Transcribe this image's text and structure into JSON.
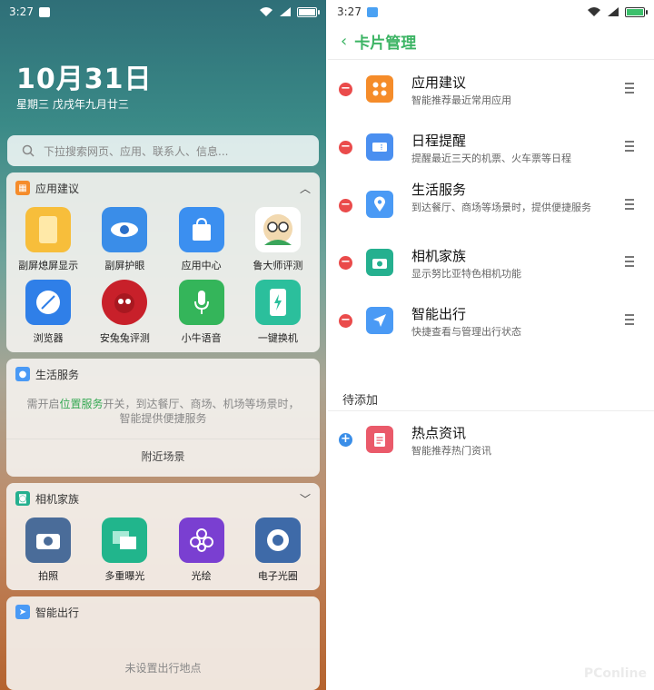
{
  "left": {
    "status": {
      "time": "3:27"
    },
    "date": "10月31日",
    "date_sub": "星期三 戊戌年九月廿三",
    "search_placeholder": "下拉搜索网页、应用、联系人、信息...",
    "app_suggest": {
      "title": "应用建议",
      "apps": [
        {
          "label": "副屏熄屏显示",
          "icon": "phone-screen-icon",
          "color": "#f5b42a"
        },
        {
          "label": "副屏护眼",
          "icon": "eye-icon",
          "color": "#3a8de8"
        },
        {
          "label": "应用中心",
          "icon": "shopping-bag-icon",
          "color": "#3b8ff0"
        },
        {
          "label": "鲁大师评测",
          "icon": "ludashi-avatar-icon",
          "color": "#ffffff"
        },
        {
          "label": "浏览器",
          "icon": "browser-icon",
          "color": "#2f7fe8"
        },
        {
          "label": "安兔兔评测",
          "icon": "antutu-icon",
          "color": "#c8202a"
        },
        {
          "label": "小牛语音",
          "icon": "microphone-icon",
          "color": "#34b55a"
        },
        {
          "label": "一键换机",
          "icon": "phone-transfer-icon",
          "color": "#2bbf9c"
        }
      ]
    },
    "life": {
      "title": "生活服务",
      "text_pre": "需开启",
      "text_link": "位置服务",
      "text_post": "开关，到达餐厅、商场、机场等场景时，智能提供便捷服务",
      "button": "附近场景"
    },
    "camera": {
      "title": "相机家族",
      "apps": [
        {
          "label": "拍照",
          "icon": "camera-icon",
          "color": "#4a6c99"
        },
        {
          "label": "多重曝光",
          "icon": "layers-icon",
          "color": "#21b58c"
        },
        {
          "label": "光绘",
          "icon": "flower-icon",
          "color": "#7a3fd1"
        },
        {
          "label": "电子光圈",
          "icon": "aperture-icon",
          "color": "#3e6aa8"
        }
      ]
    },
    "travel": {
      "title": "智能出行",
      "text": "未设置出行地点"
    }
  },
  "right": {
    "status": {
      "time": "3:27"
    },
    "title": "卡片管理",
    "cards": [
      {
        "name": "应用建议",
        "desc": "智能推荐最近常用应用",
        "icon": "apps-grid-icon",
        "color": "#f58c2a"
      },
      {
        "name": "日程提醒",
        "desc": "提醒最近三天的机票、火车票等日程",
        "icon": "ticket-icon",
        "color": "#4a8ff0"
      },
      {
        "name": "生活服务",
        "desc": "到达餐厅、商场等场景时，提供便捷服务",
        "icon": "location-pin-icon",
        "color": "#4a9af5"
      },
      {
        "name": "相机家族",
        "desc": "显示努比亚特色相机功能",
        "icon": "camera-icon",
        "color": "#25b08f"
      },
      {
        "name": "智能出行",
        "desc": "快捷查看与管理出行状态",
        "icon": "navigation-icon",
        "color": "#4a9af5"
      }
    ],
    "pending_label": "待添加",
    "pending": [
      {
        "name": "热点资讯",
        "desc": "智能推荐热门资讯",
        "icon": "news-icon",
        "color": "#ea5a6a"
      }
    ]
  }
}
